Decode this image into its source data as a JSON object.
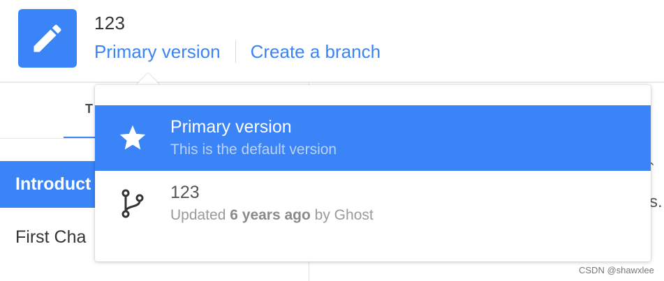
{
  "header": {
    "book_title": "123",
    "primary_link": "Primary version",
    "branch_link": "Create a branch",
    "logo_icon": "pencil-icon"
  },
  "sidebar": {
    "tab_label": "T",
    "chapters": [
      {
        "label": "Introduct",
        "active": true
      },
      {
        "label": "First Cha",
        "active": false
      }
    ]
  },
  "content_fragments": [
    "`",
    "s."
  ],
  "dropdown": {
    "items": [
      {
        "icon": "star-icon",
        "title": "Primary version",
        "subtitle": "This is the default version",
        "selected": true
      },
      {
        "icon": "branch-icon",
        "title": "123",
        "subtitle_prefix": "Updated",
        "subtitle_time": "6 years ago",
        "subtitle_suffix": "by Ghost",
        "selected": false
      }
    ]
  },
  "watermark": "CSDN @shawxlee",
  "colors": {
    "accent": "#3a84f7",
    "text": "#333333",
    "muted": "#9a9a9a"
  }
}
